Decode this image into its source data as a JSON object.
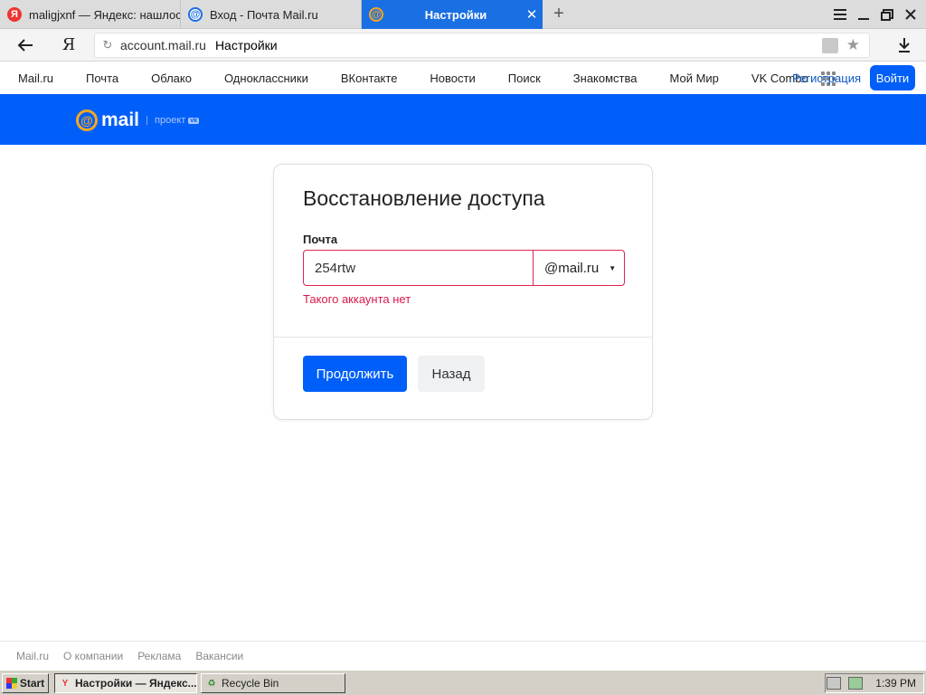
{
  "browser": {
    "tabs": [
      {
        "title": "maligjxnf — Яндекс: нашлось",
        "icon": "yandex-icon"
      },
      {
        "title": "Вход - Почта Mail.ru",
        "icon": "mailru-at-icon"
      },
      {
        "title": "Настройки",
        "icon": "mailru-at-icon",
        "active": true
      }
    ],
    "address": {
      "domain": "account.mail.ru",
      "page_title": "Настройки"
    },
    "ya_button": "Я"
  },
  "portal_nav": {
    "links": [
      "Mail.ru",
      "Почта",
      "Облако",
      "Одноклассники",
      "ВКонтакте",
      "Новости",
      "Поиск",
      "Знакомства",
      "Мой Мир",
      "VK Combo"
    ],
    "register": "Регистрация",
    "login": "Войти"
  },
  "header": {
    "logo_text": "mail",
    "project_label": "проект",
    "vk_badge": "vk"
  },
  "form": {
    "title": "Восстановление доступа",
    "field_label": "Почта",
    "email_value": "254rtw",
    "domain": "@mail.ru",
    "error": "Такого аккаунта нет",
    "continue_label": "Продолжить",
    "back_label": "Назад"
  },
  "footer": {
    "links": [
      "Mail.ru",
      "О компании",
      "Реклама",
      "Вакансии"
    ]
  },
  "taskbar": {
    "start_label": "Start",
    "windows": [
      {
        "label": "Настройки — Яндекс...",
        "active": true
      },
      {
        "label": "Recycle Bin",
        "active": false
      }
    ],
    "clock": "1:39 PM"
  },
  "colors": {
    "brand_blue": "#005ff9",
    "error_red": "#e0254d",
    "logo_orange": "#f5a623"
  }
}
